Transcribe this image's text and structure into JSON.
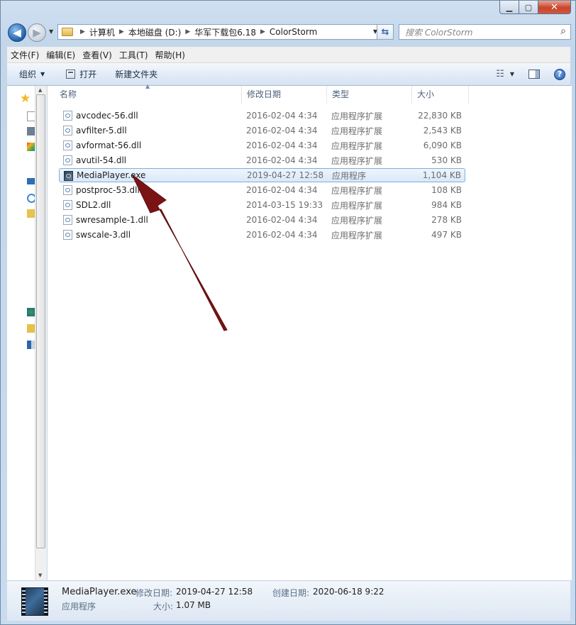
{
  "window": {
    "caption_buttons": {
      "minimize": "▁",
      "maximize": "▢",
      "close": "✕"
    }
  },
  "nav": {
    "back_glyph": "◀",
    "forward_glyph": "▶",
    "breadcrumbs": [
      "计算机",
      "本地磁盘 (D:)",
      "华军下载包6.18",
      "ColorStorm"
    ],
    "search_placeholder": "搜索 ColorStorm"
  },
  "menubar": {
    "items": [
      "文件(F)",
      "编辑(E)",
      "查看(V)",
      "工具(T)",
      "帮助(H)"
    ]
  },
  "toolbar": {
    "organize_label": "组织",
    "open_label": "打开",
    "new_folder_label": "新建文件夹"
  },
  "columns": {
    "name": "名称",
    "date": "修改日期",
    "type": "类型",
    "size": "大小"
  },
  "files": [
    {
      "name": "avcodec-56.dll",
      "date": "2016-02-04 4:34",
      "type": "应用程序扩展",
      "size": "22,830 KB",
      "icon": "dll-file-icon"
    },
    {
      "name": "avfilter-5.dll",
      "date": "2016-02-04 4:34",
      "type": "应用程序扩展",
      "size": "2,543 KB",
      "icon": "dll-file-icon"
    },
    {
      "name": "avformat-56.dll",
      "date": "2016-02-04 4:34",
      "type": "应用程序扩展",
      "size": "6,090 KB",
      "icon": "dll-file-icon"
    },
    {
      "name": "avutil-54.dll",
      "date": "2016-02-04 4:34",
      "type": "应用程序扩展",
      "size": "530 KB",
      "icon": "dll-file-icon"
    },
    {
      "name": "MediaPlayer.exe",
      "date": "2019-04-27 12:58",
      "type": "应用程序",
      "size": "1,104 KB",
      "icon": "exe-file-icon",
      "selected": true
    },
    {
      "name": "postproc-53.dll",
      "date": "2016-02-04 4:34",
      "type": "应用程序扩展",
      "size": "108 KB",
      "icon": "dll-file-icon"
    },
    {
      "name": "SDL2.dll",
      "date": "2014-03-15 19:33",
      "type": "应用程序扩展",
      "size": "984 KB",
      "icon": "dll-file-icon"
    },
    {
      "name": "swresample-1.dll",
      "date": "2016-02-04 4:34",
      "type": "应用程序扩展",
      "size": "278 KB",
      "icon": "dll-file-icon"
    },
    {
      "name": "swscale-3.dll",
      "date": "2016-02-04 4:34",
      "type": "应用程序扩展",
      "size": "497 KB",
      "icon": "dll-file-icon"
    }
  ],
  "details": {
    "name": "MediaPlayer.exe",
    "type": "应用程序",
    "modified_label": "修改日期:",
    "modified_value": "2019-04-27 12:58",
    "created_label": "创建日期:",
    "created_value": "2020-06-18 9:22",
    "size_label": "大小:",
    "size_value": "1.07 MB"
  },
  "colors": {
    "selection_border": "#84acdd",
    "annotation_arrow": "#7a1414"
  }
}
